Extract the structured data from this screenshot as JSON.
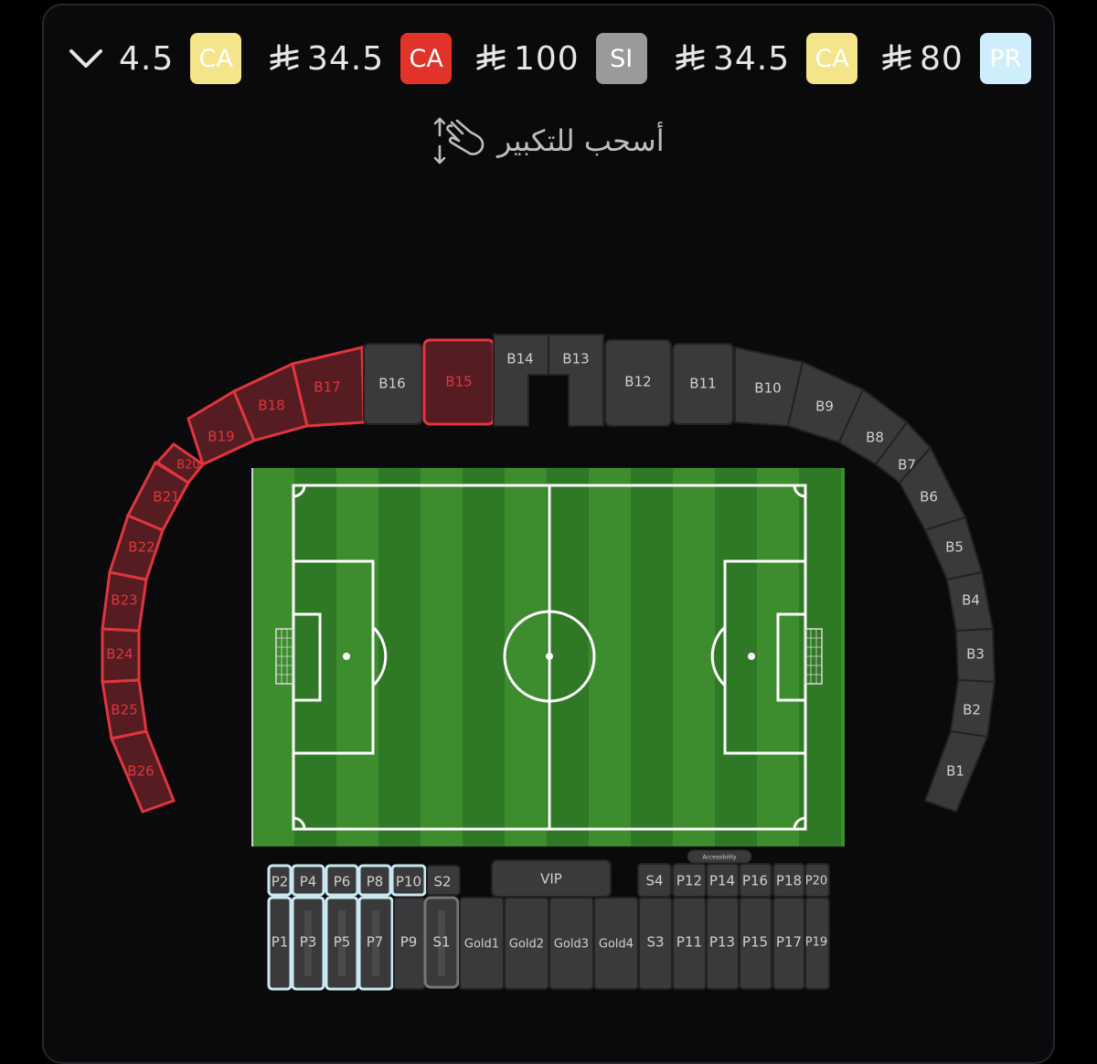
{
  "header": {
    "prices": [
      {
        "amount": "4.5",
        "badge": "CA",
        "badge_color": "#f4e58a",
        "badge_text_color": "#ffffff",
        "currency_icon": false
      },
      {
        "amount": "34.5",
        "badge": "CA",
        "badge_color": "#e2332a",
        "badge_text_color": "#ffffff",
        "currency_icon": true
      },
      {
        "amount": "100",
        "badge": "SI",
        "badge_color": "#9a9a9a",
        "badge_text_color": "#ffffff",
        "currency_icon": true
      },
      {
        "amount": "34.5",
        "badge": "CA",
        "badge_color": "#f4e58a",
        "badge_text_color": "#ffffff",
        "currency_icon": true
      },
      {
        "amount": "80",
        "badge": "PR",
        "badge_color": "#cdeefa",
        "badge_text_color": "#ffffff",
        "currency_icon": true
      }
    ],
    "currency_icon": "saudi-riyal-icon",
    "collapse_icon": "chevron-down-icon"
  },
  "hint": {
    "text": "أسحب للتكبير",
    "icon": "pinch-zoom-hand-icon"
  },
  "colors": {
    "available_red": "#e0353f",
    "unavailable_gray": "#3a3a3c",
    "selected_outline": "#c9e8f2",
    "pitch_light": "#3d8d2e",
    "pitch_dark": "#27661f"
  },
  "stadium": {
    "upper_ring_red": [
      "B17",
      "B18",
      "B19",
      "B20",
      "B21",
      "B22",
      "B23",
      "B24",
      "B25",
      "B26"
    ],
    "upper_ring_gray": [
      "B1",
      "B2",
      "B3",
      "B4",
      "B5",
      "B6",
      "B7",
      "B8",
      "B9",
      "B10"
    ],
    "top_blocks": {
      "B16": "B16",
      "B15": "B15",
      "B14": "B14",
      "B13": "B13",
      "B12": "B12",
      "B11": "B11"
    },
    "lower_top_row": [
      "P2",
      "P4",
      "P6",
      "P8",
      "P10",
      "S2"
    ],
    "vip": "VIP",
    "accessibility": "Accessibility",
    "right_top_row": [
      "S4",
      "P12",
      "P14",
      "P16",
      "P18",
      "P20"
    ],
    "lower_bottom_row": [
      "P1",
      "P3",
      "P5",
      "P7",
      "P9",
      "S1",
      "Gold1",
      "Gold2",
      "Gold3",
      "Gold4",
      "S3",
      "P11",
      "P13",
      "P15",
      "P17",
      "P19"
    ]
  }
}
